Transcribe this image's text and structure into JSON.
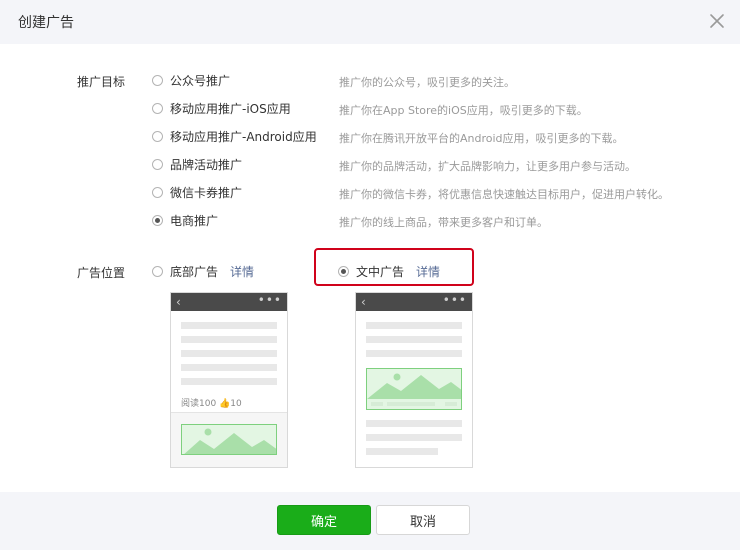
{
  "dialog": {
    "title": "创建广告"
  },
  "promotion_goal": {
    "label": "推广目标",
    "options": [
      {
        "label": "公众号推广",
        "desc": "推广你的公众号，吸引更多的关注。",
        "checked": false
      },
      {
        "label": "移动应用推广-iOS应用",
        "desc": "推广你在App Store的iOS应用，吸引更多的下载。",
        "checked": false
      },
      {
        "label": "移动应用推广-Android应用",
        "desc": "推广你在腾讯开放平台的Android应用，吸引更多的下载。",
        "checked": false
      },
      {
        "label": "品牌活动推广",
        "desc": "推广你的品牌活动，扩大品牌影响力，让更多用户参与活动。",
        "checked": false
      },
      {
        "label": "微信卡券推广",
        "desc": "推广你的微信卡券，将优惠信息快速触达目标用户，促进用户转化。",
        "checked": false
      },
      {
        "label": "电商推广",
        "desc": "推广你的线上商品，带来更多客户和订单。",
        "checked": true
      }
    ]
  },
  "ad_position": {
    "label": "广告位置",
    "options": [
      {
        "label": "底部广告",
        "detail": "详情",
        "checked": false
      },
      {
        "label": "文中广告",
        "detail": "详情",
        "checked": true
      }
    ],
    "preview_bottom": {
      "meta": "阅读100 👍10"
    }
  },
  "footer": {
    "confirm": "确定",
    "cancel": "取消"
  },
  "colors": {
    "primary": "#1aad19",
    "link": "#576b95",
    "highlight": "#d0021b"
  }
}
